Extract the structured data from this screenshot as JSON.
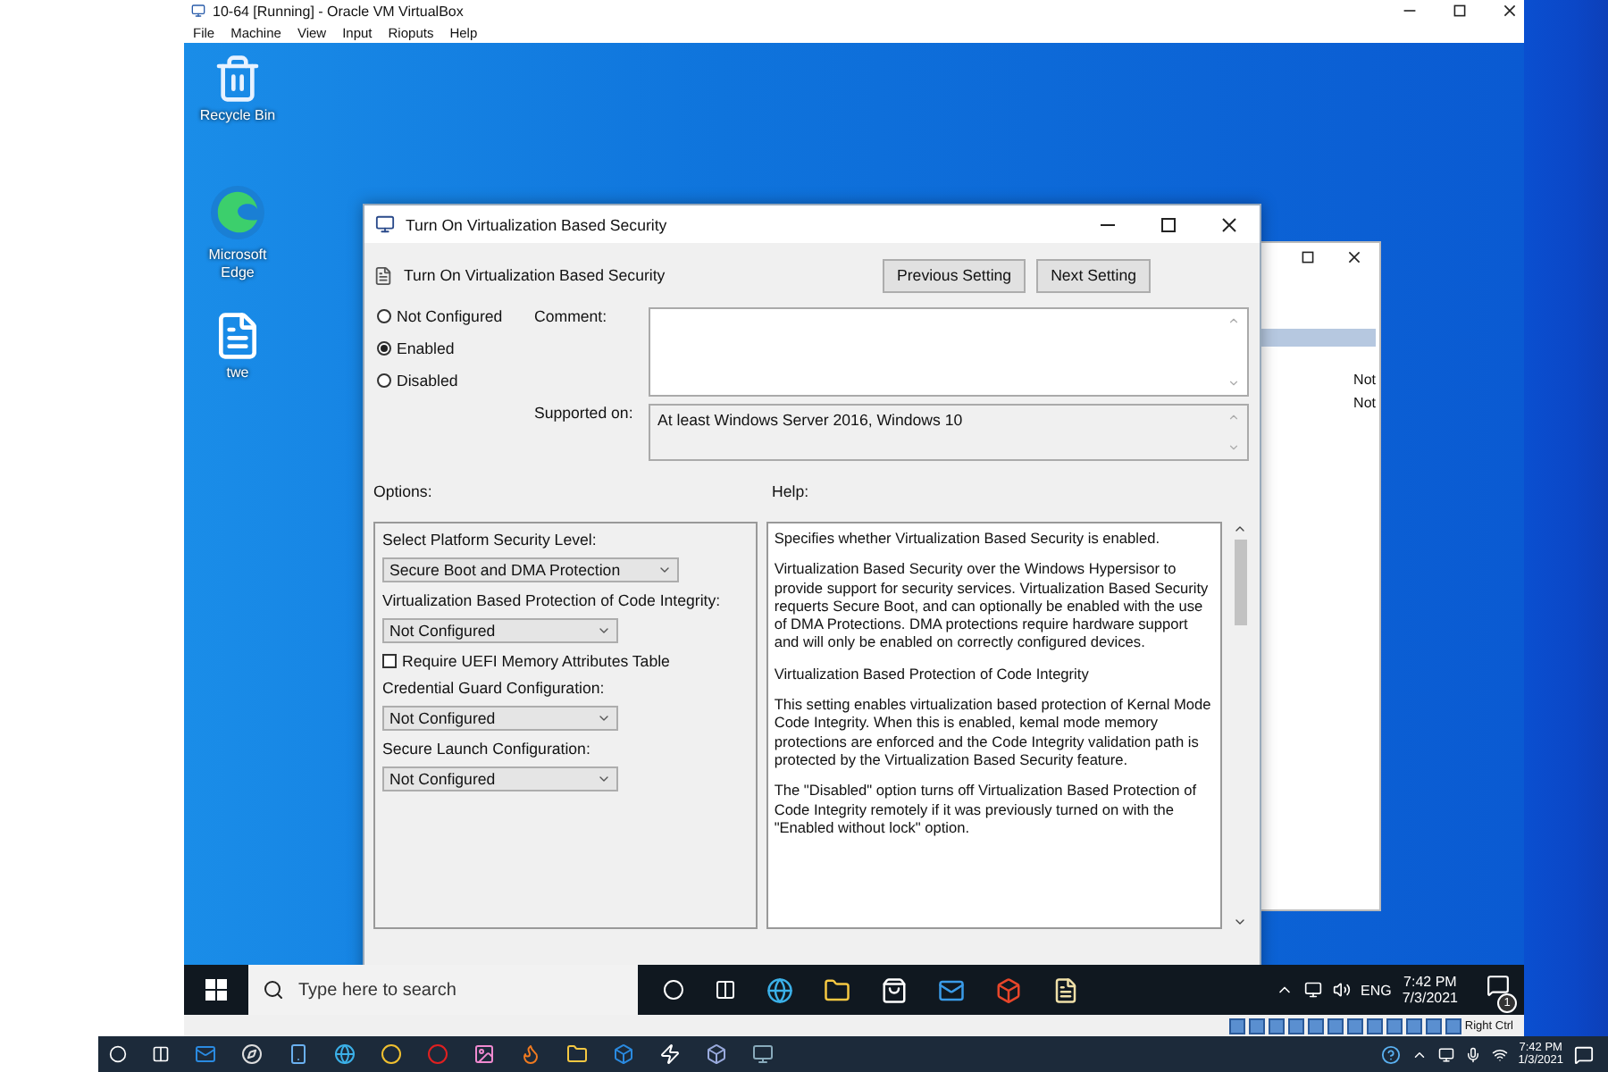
{
  "host_window": {
    "title": "10-64 [Running] - Oracle VM VirtualBox",
    "menu": [
      "File",
      "Machine",
      "View",
      "Input",
      "Rioputs",
      "Help"
    ]
  },
  "desktop_icons": [
    {
      "label": "Recycle Bin",
      "kind": "bin"
    },
    {
      "label": "Microsoft Edge",
      "kind": "edge"
    },
    {
      "label": "twe",
      "kind": "file"
    }
  ],
  "background_window": {
    "rows": [
      "Not",
      "Not"
    ]
  },
  "dialog": {
    "title": "Turn On Virtualization Based Security",
    "header_title": "Turn On Virtualization Based Security",
    "buttons": [
      "Previous Setting",
      "Next Setting"
    ],
    "states": [
      {
        "label": "Not Configured",
        "selected": false
      },
      {
        "label": "Enabled",
        "selected": true
      },
      {
        "label": "Disabled",
        "selected": false
      }
    ],
    "comment_label": "Comment:",
    "supported_label": "Supported on:",
    "supported_value": "At least Windows Server 2016, Windows 10",
    "options_label": "Options:",
    "help_label": "Help:",
    "options": [
      {
        "kind": "label",
        "text": "Select Platform Security Level:"
      },
      {
        "kind": "select",
        "value": "Secure Boot and DMA Protection"
      },
      {
        "kind": "label",
        "text": "Virtualization Based Protection of Code Integrity:"
      },
      {
        "kind": "select",
        "value": "Not Configured"
      },
      {
        "kind": "checkbox",
        "text": "Require UEFI Memory Attributes Table",
        "checked": false
      },
      {
        "kind": "label",
        "text": "Credential Guard Configuration:"
      },
      {
        "kind": "select",
        "value": "Not Configured"
      },
      {
        "kind": "label",
        "text": "Secure Launch Configuration:"
      },
      {
        "kind": "select",
        "value": "Not Configured"
      }
    ],
    "help": [
      "Specifies whether Virtualization Based Security is enabled.",
      "Virtualization Based Security over the Windows Hypersisor to provide support for security services. Virtualization Based Security requerts Secure Boot, and can optionally be enabled with the use of DMA Protections. DMA protections require hardware support and will only be enabled on correctly configured devices.",
      "Virtualization Based Protection of Code Integrity",
      "This setting enables virtualization based protection of Kernal Mode Code Integrity. When this is enabled, kemal mode memory protections are enforced and the Code Integrity validation path is protected by the Virtualization Based Security feature.",
      "The \"Disabled\" option turns off Virtualization Based Protection of Code Integrity remotely if it was previously turned on with the \"Enabled without lock\" option."
    ]
  },
  "guest_taskbar": {
    "search_placeholder": "Type here to search",
    "language": "ENG",
    "time": "7:42 PM",
    "date": "7/3/2021",
    "notification_count": "1"
  },
  "vm_status": {
    "host_key": "Right Ctrl"
  },
  "host_taskbar": {
    "time": "7:42 PM",
    "date": "1/3/2021"
  }
}
